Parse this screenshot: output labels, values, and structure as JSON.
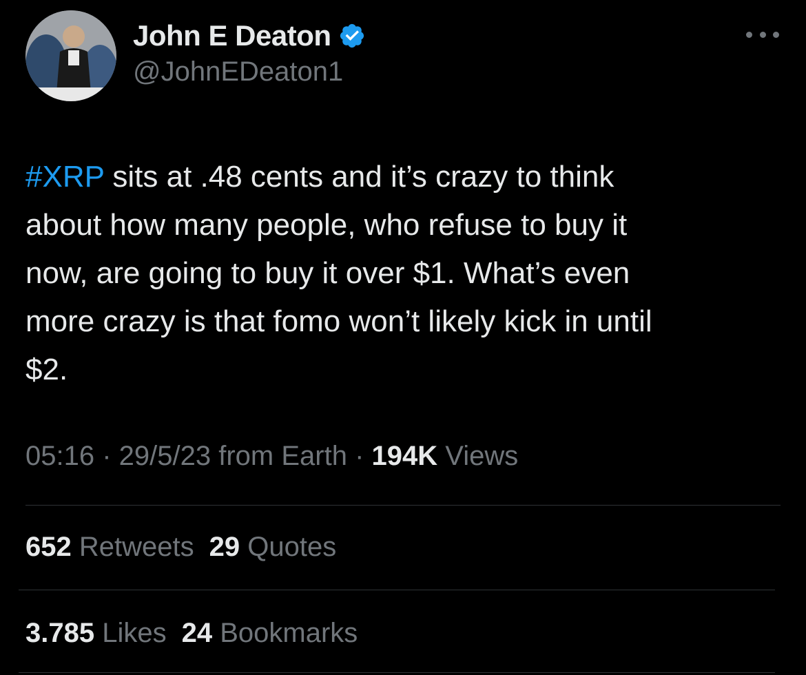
{
  "author": {
    "name": "John E Deaton",
    "handle": "@JohnEDeaton1",
    "verified": true,
    "avatar_icon": "profile-photo"
  },
  "tweet": {
    "hashtag": "#XRP",
    "line1_rest": " sits at .48 cents and it’s crazy to think",
    "line2": "about how many people, who refuse to buy it",
    "line3": "now, are going to buy it over $1. What’s even",
    "line4": "more crazy is that fomo won’t likely kick in until",
    "line5": "$2."
  },
  "meta": {
    "time": "05:16",
    "sep1": " · ",
    "date": "29/5/23",
    "source": " from Earth",
    "sep2": " · ",
    "views_count": "194K",
    "views_label": " Views"
  },
  "stats": {
    "retweets_count": "652",
    "retweets_label": " Retweets",
    "quotes_count": "29",
    "quotes_label": " Quotes",
    "likes_count": "3.785",
    "likes_label": " Likes",
    "bookmarks_count": "24",
    "bookmarks_label": " Bookmarks"
  },
  "colors": {
    "background": "#000000",
    "accent": "#1d9bf0",
    "text_primary": "#e7e9ea",
    "text_secondary": "#71767b",
    "divider": "#2f3336"
  },
  "icons": {
    "verified": "verified-badge-icon",
    "more": "more-options-icon"
  }
}
